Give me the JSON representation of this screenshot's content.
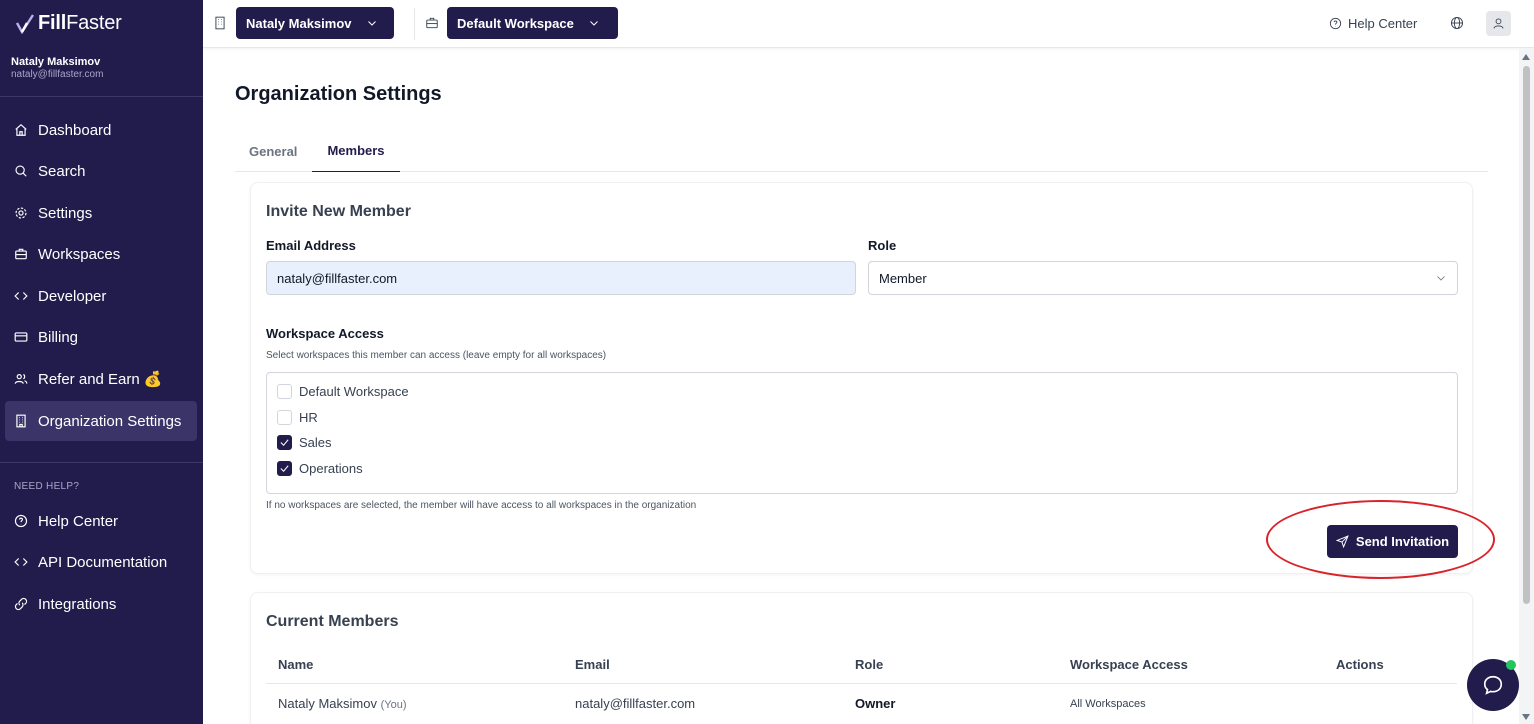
{
  "app": {
    "logo_prefix": "Fill",
    "logo_suffix": "Faster"
  },
  "user": {
    "name": "Nataly Maksimov",
    "email": "nataly@fillfaster.com"
  },
  "sidebar": {
    "items": [
      {
        "label": "Dashboard",
        "icon": "home-icon"
      },
      {
        "label": "Search",
        "icon": "search-icon"
      },
      {
        "label": "Settings",
        "icon": "gear-icon"
      },
      {
        "label": "Workspaces",
        "icon": "briefcase-icon"
      },
      {
        "label": "Developer",
        "icon": "code-icon"
      },
      {
        "label": "Billing",
        "icon": "credit-card-icon"
      },
      {
        "label": "Refer and Earn 💰",
        "icon": "users-icon"
      },
      {
        "label": "Organization Settings",
        "icon": "building-icon",
        "active": true
      }
    ],
    "help_heading": "NEED HELP?",
    "help_items": [
      {
        "label": "Help Center",
        "icon": "help-circle-icon"
      },
      {
        "label": "API Documentation",
        "icon": "code-icon"
      },
      {
        "label": "Integrations",
        "icon": "link-icon"
      }
    ]
  },
  "topbar": {
    "org_selector": "Nataly Maksimov",
    "workspace_selector": "Default Workspace",
    "help_center": "Help Center"
  },
  "page": {
    "title": "Organization Settings",
    "tabs": [
      "General",
      "Members"
    ],
    "active_tab": "Members"
  },
  "invite": {
    "title": "Invite New Member",
    "email_label": "Email Address",
    "email_value": "nataly@fillfaster.com",
    "role_label": "Role",
    "role_value": "Member",
    "workspace_label": "Workspace Access",
    "workspace_hint": "Select workspaces this member can access (leave empty for all workspaces)",
    "workspaces": [
      {
        "label": "Default Workspace",
        "checked": false
      },
      {
        "label": "HR",
        "checked": false
      },
      {
        "label": "Sales",
        "checked": true
      },
      {
        "label": "Operations",
        "checked": true
      }
    ],
    "footer_hint": "If no workspaces are selected, the member will have access to all workspaces in the organization",
    "send_button": "Send Invitation"
  },
  "members": {
    "title": "Current Members",
    "columns": [
      "Name",
      "Email",
      "Role",
      "Workspace Access",
      "Actions"
    ],
    "rows": [
      {
        "name": "Nataly Maksimov",
        "you": "(You)",
        "email": "nataly@fillfaster.com",
        "role": "Owner",
        "access": "All Workspaces"
      }
    ]
  },
  "colors": {
    "brand": "#221c4d",
    "annotation": "#d9222a",
    "online": "#22c55e"
  }
}
